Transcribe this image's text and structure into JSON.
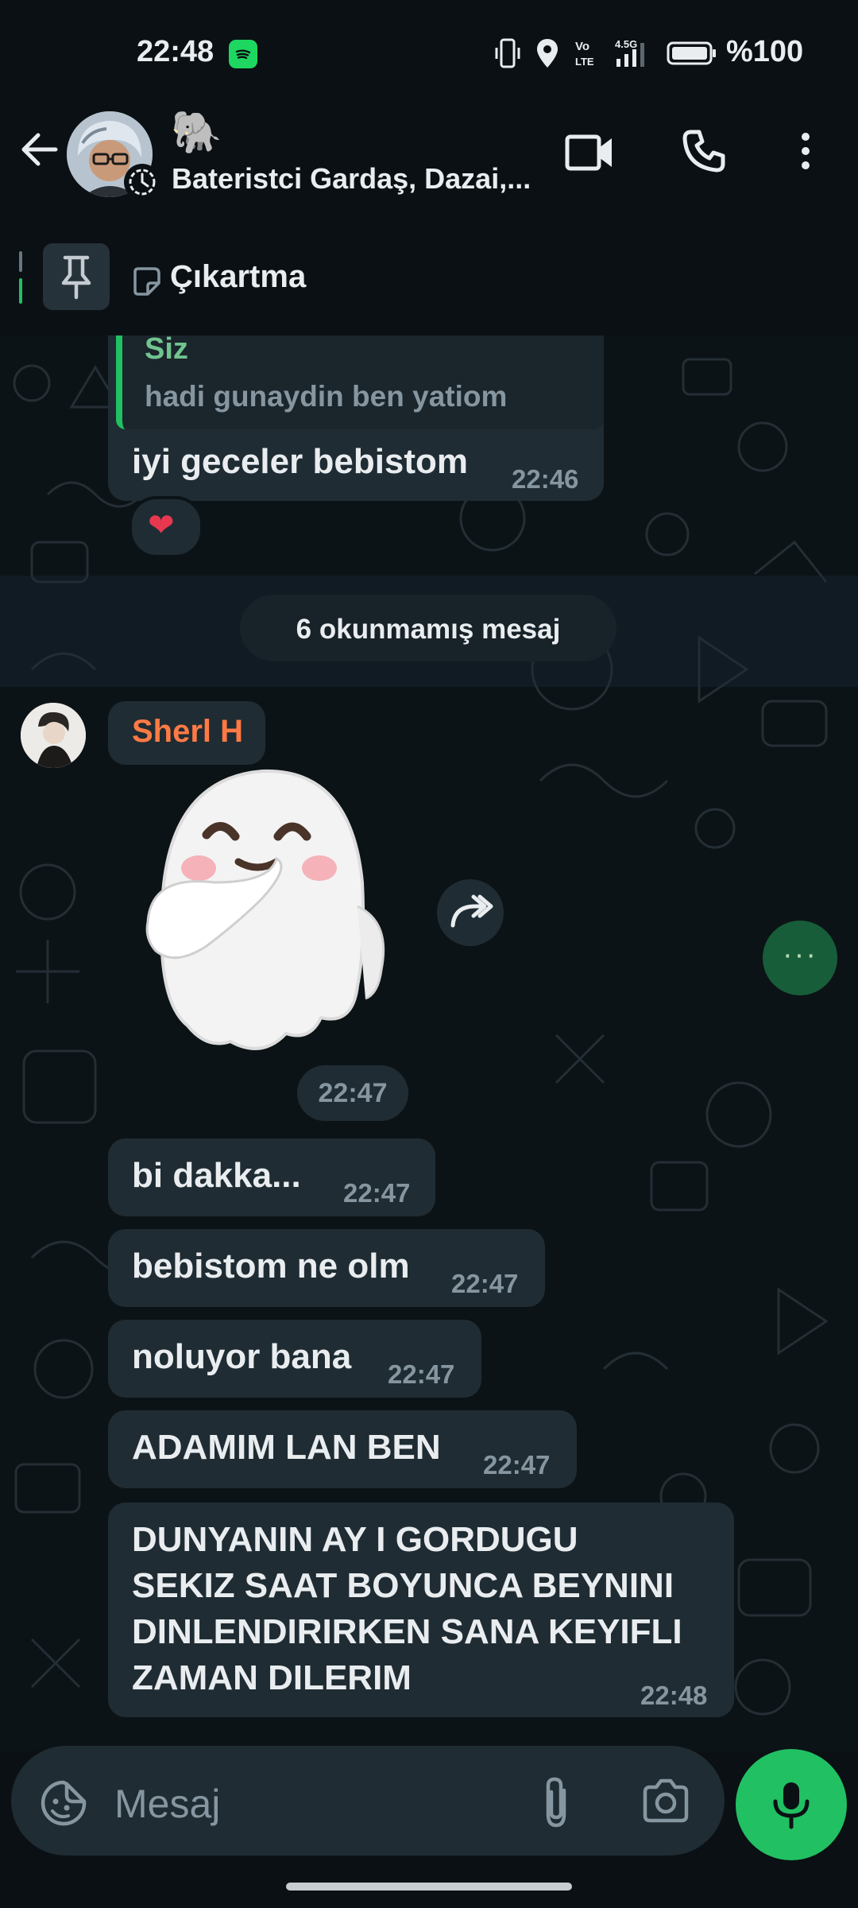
{
  "status_bar": {
    "time": "22:48",
    "battery": "%100",
    "icons": [
      "spotify-icon",
      "vibrate-icon",
      "location-icon",
      "volte-icon",
      "signal-icon",
      "battery-icon"
    ]
  },
  "header": {
    "title": "Bateristci Gardaş, Dazai,...",
    "emoji": "🐘",
    "icons": [
      "back-arrow-icon",
      "group-avatar",
      "disappearing-timer-icon",
      "video-call-icon",
      "voice-call-icon",
      "more-vertical-icon"
    ]
  },
  "pinned": {
    "label": "Çıkartma",
    "icons": [
      "pin-icon",
      "sticker-icon"
    ]
  },
  "messages": {
    "quoted": {
      "author": "Siz",
      "quote": "hadi gunaydin ben yatiom",
      "text": "iyi geceler bebistom",
      "time": "22:46",
      "reaction": "❤"
    },
    "unread_label": "6 okunmamış mesaj",
    "sender_name": "Sherl H",
    "sticker_time": "22:47",
    "items": [
      {
        "text": "bi dakka...",
        "time": "22:47"
      },
      {
        "text": "bebistom ne olm",
        "time": "22:47"
      },
      {
        "text": "noluyor bana",
        "time": "22:47"
      },
      {
        "text": "ADAMIM LAN BEN",
        "time": "22:47"
      },
      {
        "lines": [
          "DUNYANIN AY I GORDUGU",
          "SEKIZ SAAT BOYUNCA BEYNINI",
          "DINLENDIRIRKEN SANA KEYIFLI",
          "ZAMAN DILERIM"
        ],
        "time": "22:48"
      }
    ],
    "fab_dots": "···"
  },
  "input": {
    "placeholder": "Mesaj",
    "icons": [
      "emoji-sticker-icon",
      "attach-icon",
      "camera-icon",
      "mic-icon"
    ]
  },
  "colors": {
    "accent_green": "#21c063",
    "bubble": "#1f2c33",
    "background": "#0b1014",
    "sender_name": "#ff7a45",
    "quote_author": "#71c48f"
  }
}
